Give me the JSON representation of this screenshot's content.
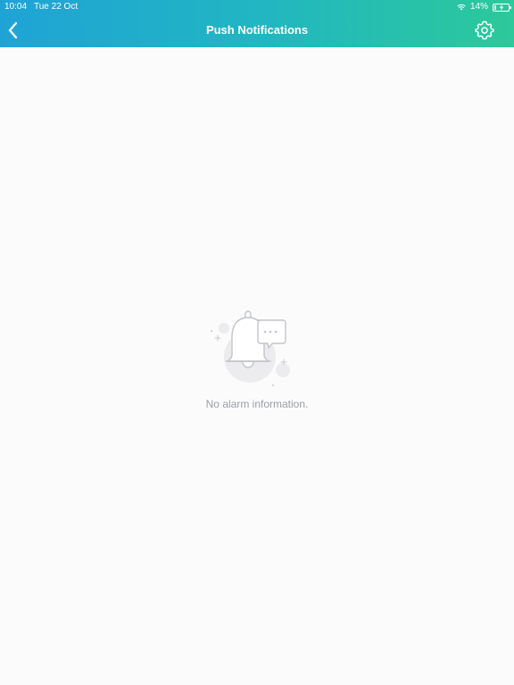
{
  "status_bar": {
    "time": "10:04",
    "date": "Tue 22 Oct",
    "battery_percent": "14%",
    "battery_level": 0.14
  },
  "header": {
    "title": "Push Notifications",
    "back_icon": "chevron-left-icon",
    "settings_icon": "gear-icon",
    "gradient_start": "#1fa3d6",
    "gradient_end": "#2cc99a"
  },
  "empty_state": {
    "icon": "bell-icon",
    "message": "No alarm information."
  }
}
